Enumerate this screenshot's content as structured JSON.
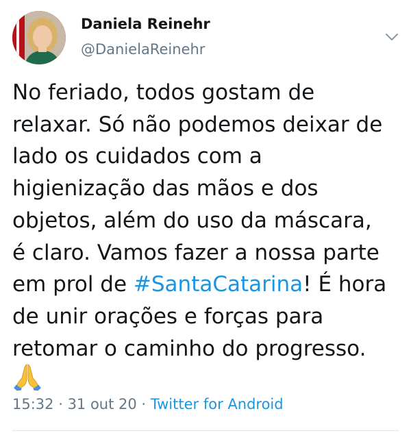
{
  "author": {
    "name": "Daniela Reinehr",
    "handle": "@DanielaReinehr",
    "avatar_icon": "profile-photo-woman-icon"
  },
  "menu": {
    "icon": "chevron-down-icon"
  },
  "tweet": {
    "lines": [
      "No feriado, todos gostam de",
      "relaxar. Só não podemos deixar de",
      "lado os cuidados com a",
      "higienização das mãos e dos",
      "objetos, além do uso da máscara,",
      "é claro. Vamos fazer a nossa parte"
    ],
    "line7_before": "em prol de ",
    "hashtag": "#SantaCatarina",
    "line7_after": "! É hora",
    "line8": "de unir orações e forças para",
    "line9": "retomar o caminho do progresso.",
    "emoji_icon": "folded-hands-icon"
  },
  "meta": {
    "time": "15:32",
    "sep1": " · ",
    "date": "31 out 20",
    "sep2": " · ",
    "source": "Twitter for Android"
  },
  "colors": {
    "link": "#1b95e0",
    "secondary_text": "#657786",
    "primary_text": "#14171a"
  }
}
